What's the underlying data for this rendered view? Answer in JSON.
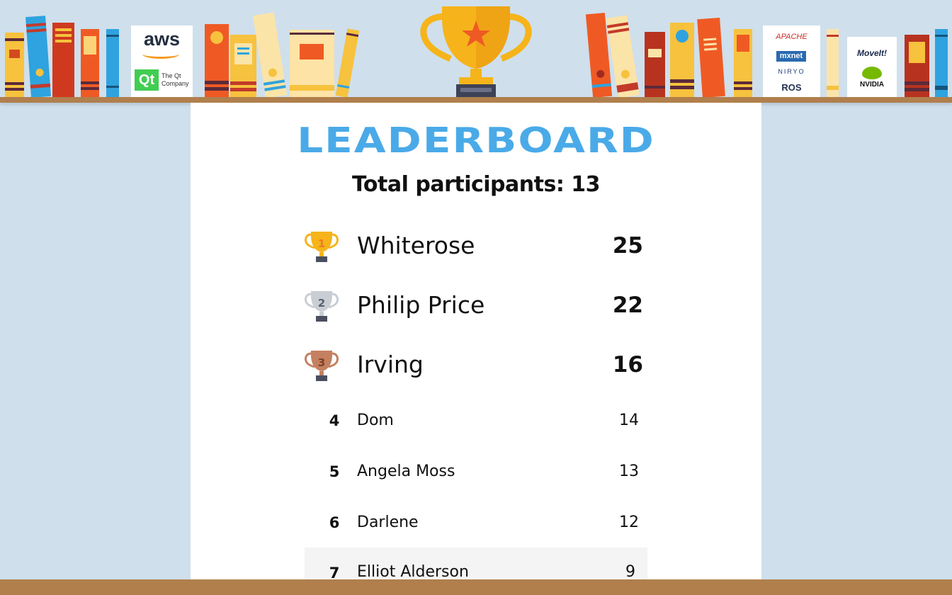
{
  "header": {
    "sponsors_left": {
      "aws": "aws",
      "qt": "Qt",
      "qt_company": "The Qt Company"
    },
    "sponsors_right": {
      "apache": "APACHE",
      "mxnet": "mxnet",
      "niryo": "NIRYO",
      "ros": "ROS",
      "moveit": "MoveIt!",
      "nvidia": "NVIDIA"
    }
  },
  "leaderboard": {
    "title": "LEADERBOARD",
    "total_label": "Total participants: 13",
    "top": [
      {
        "rank": "1",
        "name": "Whiterose",
        "score": "25",
        "trophy": "gold-trophy-icon"
      },
      {
        "rank": "2",
        "name": "Philip Price",
        "score": "22",
        "trophy": "silver-trophy-icon"
      },
      {
        "rank": "3",
        "name": "Irving",
        "score": "16",
        "trophy": "bronze-trophy-icon"
      }
    ],
    "rows": [
      {
        "rank": "4",
        "name": "Dom",
        "score": "14"
      },
      {
        "rank": "5",
        "name": "Angela Moss",
        "score": "13"
      },
      {
        "rank": "6",
        "name": "Darlene",
        "score": "12"
      },
      {
        "rank": "7",
        "name": "Elliot Alderson",
        "score": "9"
      }
    ]
  },
  "colors": {
    "background": "#cfdfec",
    "title": "#4aaae8",
    "shelf": "#b07f4c",
    "gold": "#f6b41a",
    "silver": "#b8bec6",
    "bronze": "#c48060"
  }
}
